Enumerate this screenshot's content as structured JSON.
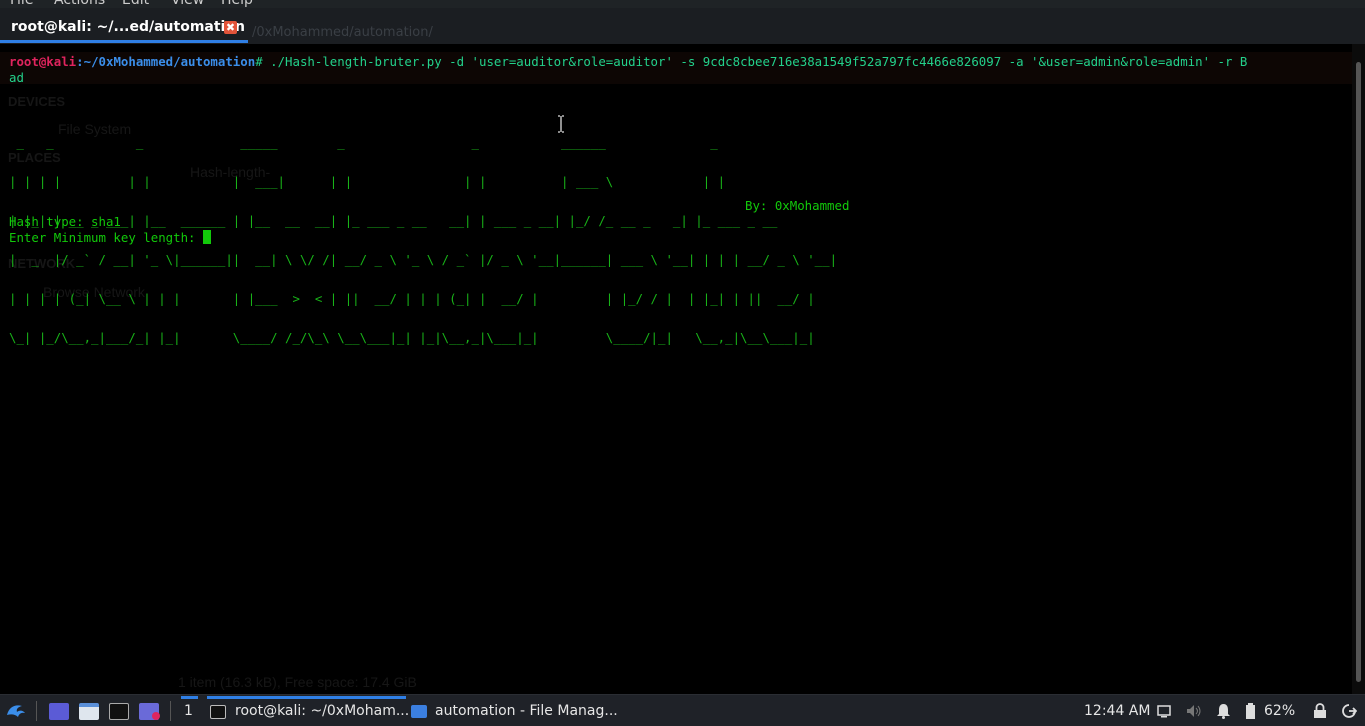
{
  "menu": [
    "File",
    "Actions",
    "Edit",
    "View",
    "Help"
  ],
  "tab": {
    "title": "root@kali: ~/...ed/automation",
    "close": "✖"
  },
  "ghost": {
    "path": "/0xMohammed/automation/",
    "devices": "DEVICES",
    "system": "File System",
    "places": "PLACES",
    "network": "NETWORK",
    "browse": "Browse Network",
    "hash": "Hash-length-",
    "status": "1 item (16.3 kB), Free space: 17.4 GiB"
  },
  "terminal": {
    "prompt_user": "root@kali",
    "prompt_sep": ":",
    "prompt_path": "~/0xMohammed/automation",
    "prompt_end": "# ",
    "command": "./Hash-length-bruter.py -d 'user=auditor&role=auditor' -s 9cdc8cbee716e38a1549f52a797fc4466e826097 -a '&user=admin&role=admin' -r B",
    "command_wrap": "ad",
    "banner": [
      " _   _           _             _____        _                 _           ______              _",
      "| | | |         | |           |  ___|      | |               | |          | ___ \\            | |",
      "| |_| | __ _ ___| |__  ______ | |__  __  __| |_ ___ _ __   __| | ___ _ __| |_/ /_ __ _   _| |_ ___ _ __",
      "|  _  |/ _` / __| '_ \\|______||  __| \\ \\/ /| __/ _ \\ '_ \\ / _` |/ _ \\ '__|______| ___ \\ '__| | | | __/ _ \\ '__|",
      "| | | | (_| \\__ \\ | | |       | |___  >  < | ||  __/ | | | (_| |  __/ |         | |_/ / |  | |_| | ||  __/ |",
      "\\_| |_/\\__,_|___/_| |_|       \\____/ /_/\\_\\ \\__\\___|_| |_|\\__,_|\\___|_|         \\____/|_|   \\__,_|\\__\\___|_|"
    ],
    "byline": "By: 0xMohammed",
    "hash_type": "Hash type: sha1",
    "min_key": "Enter Minimum key length: "
  },
  "taskbar": {
    "workspace": "1",
    "task1": "root@kali: ~/0xMoham...",
    "task2": "automation - File Manag...",
    "clock": "12:44 AM",
    "battery": "62%"
  },
  "colors": {
    "accent": "#2f7fe5",
    "prompt_user": "#e0245e",
    "prompt_path": "#3b8eea",
    "banner": "#18b318"
  }
}
